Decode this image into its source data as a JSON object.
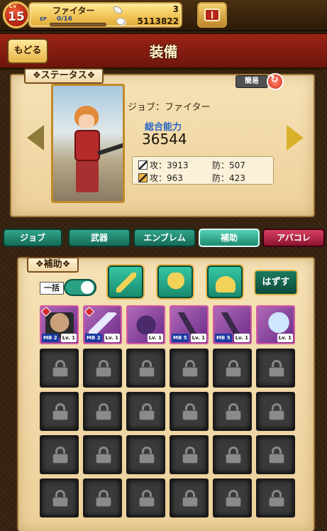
{
  "player": {
    "lv_tag": "Lv",
    "level": "15",
    "name": "ファイター",
    "ep_label": "EP",
    "ep_value": "0/16",
    "ep_fraction": 0.0,
    "gems": "3",
    "gold": "5113822"
  },
  "header": {
    "back_label": "もどる",
    "title": "装備"
  },
  "status": {
    "section_label": "❖ステータス❖",
    "simple_label": "簡易",
    "job_line": "ジョブ：ファイター",
    "power_label": "総合能力",
    "power_value": "36544",
    "phys_atk": "攻：3913",
    "phys_def": "防：507",
    "mag_atk": "攻：963",
    "mag_def": "防：423"
  },
  "tabs": [
    {
      "label": "ジョブ"
    },
    {
      "label": "武器"
    },
    {
      "label": "エンブレム"
    },
    {
      "label": "補助"
    },
    {
      "label": "アバコレ"
    }
  ],
  "support": {
    "section_label": "❖補助❖",
    "bulk_label": "一括",
    "toggle_on": true,
    "unequip_label": "はずす",
    "categories": [
      "sword-icon",
      "armor-icon",
      "helmet-icon"
    ],
    "cards": [
      {
        "art": "man",
        "mb": "MB 2",
        "lv": "Lv. 1"
      },
      {
        "art": "sword",
        "mb": "MB 2",
        "lv": "Lv. 1"
      },
      {
        "art": "demon",
        "mb": "",
        "lv": "Lv. 1"
      },
      {
        "art": "bow",
        "mb": "MB 5",
        "lv": "Lv. 1"
      },
      {
        "art": "bow",
        "mb": "MB 5",
        "lv": "Lv. 1"
      },
      {
        "art": "wing",
        "mb": "",
        "lv": "Lv. 1"
      }
    ],
    "locked_slots": 24
  },
  "colors": {
    "tab_green": "#1d8a70",
    "tab_pink": "#8c1230",
    "banner_red": "#9a2416",
    "parchment": "#f6e2b6"
  }
}
